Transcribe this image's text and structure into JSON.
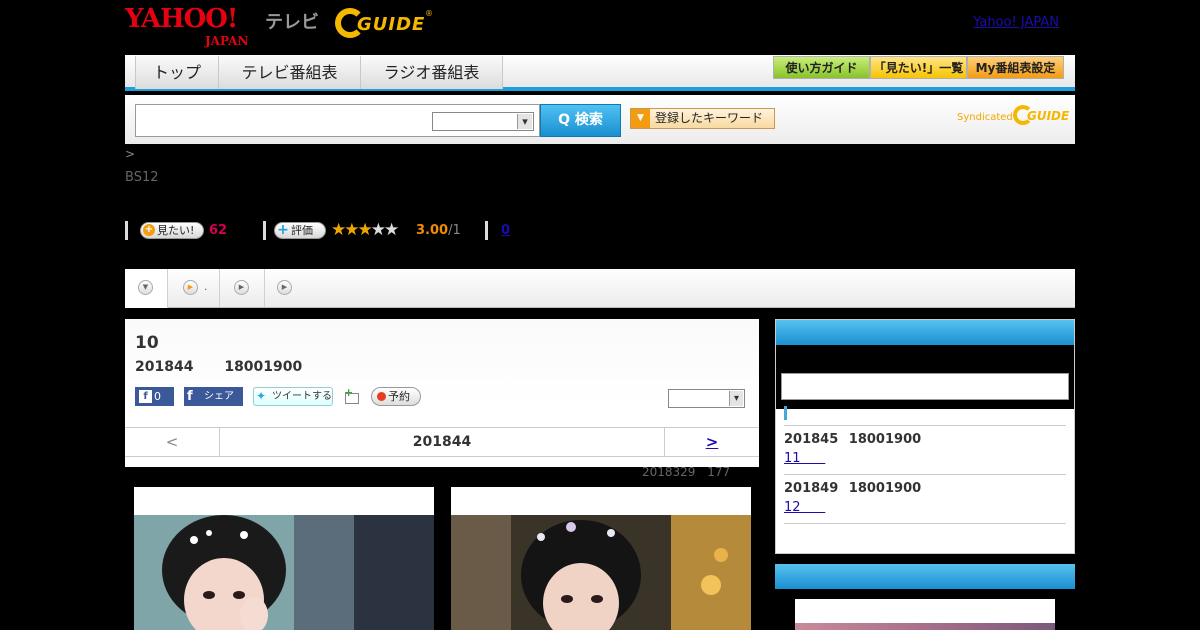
{
  "header": {
    "yahoo_logo": "YAHOO!",
    "yahoo_japan": "JAPAN",
    "tv_label": "テレビ",
    "gguide_logo": "GUIDE",
    "gguide_reg": "®",
    "yahoo_japan_link": "Yahoo! JAPAN"
  },
  "nav": {
    "tabs": [
      {
        "label": "トップ"
      },
      {
        "label": "テレビ番組表"
      },
      {
        "label": "ラジオ番組表"
      }
    ],
    "right_buttons": [
      {
        "label": "使い方ガイド",
        "color": "#89c22b"
      },
      {
        "label": "「見たい!」一覧",
        "color": "#f7c400"
      },
      {
        "label": "My番組表設定",
        "color": "#f39c12"
      }
    ]
  },
  "search": {
    "input_value": "",
    "select_value": "",
    "button_label": "Q 検索",
    "keyword_button": "登録したキーワード",
    "syndicated_label": "Syndicated",
    "syndicated_logo": "GUIDE"
  },
  "breadcrumb": ">",
  "channel": "BS12",
  "rating": {
    "mitai_label": "見たい!",
    "mitai_count": "62",
    "eval_label": "評価",
    "stars_on": "★★★",
    "stars_off": "★★",
    "score": "3.00",
    "score_den": "/1",
    "comments": "0"
  },
  "program_tabs": [
    {
      "icon": "chevron-down-icon"
    },
    {
      "icon": "play-icon",
      "label": "."
    },
    {
      "icon": "play-icon"
    },
    {
      "icon": "play-icon"
    }
  ],
  "episode": {
    "number": "10",
    "datetime": "201844 18001900",
    "fb_like_count": "0",
    "fb_share": "シェア",
    "tweet": "ツイートする",
    "reserve": "予約",
    "select_value": ""
  },
  "pager": {
    "prev": "<",
    "current": "201844",
    "next": ">"
  },
  "meta_date": "2018329 177",
  "sidebar": {
    "header": "",
    "input_value": "",
    "items": [
      {
        "datetime": "201845 18001900",
        "episode": "11      "
      },
      {
        "datetime": "201849 18001900",
        "episode": "12      "
      }
    ]
  },
  "colors": {
    "accent": "#1ea0dc",
    "brand_red": "#e60012",
    "gguide_yellow": "#f5b800",
    "background": "#000000"
  }
}
